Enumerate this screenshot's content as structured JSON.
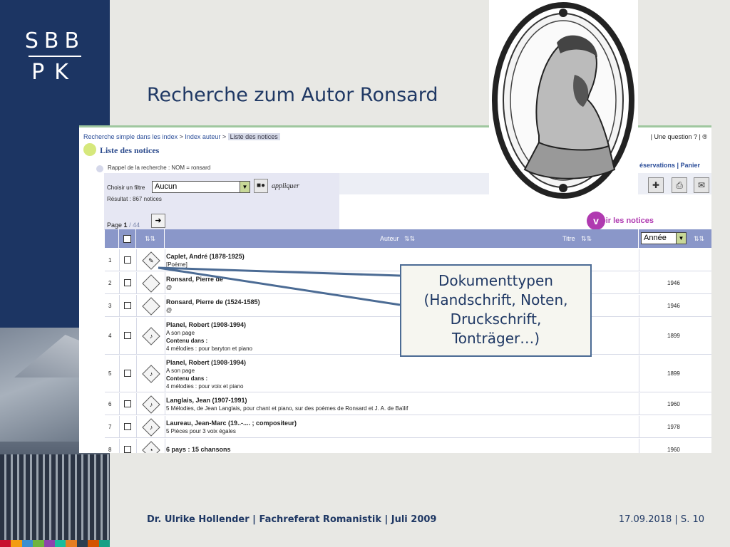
{
  "logo": {
    "line1": "SBB",
    "line2": "PK"
  },
  "slide": {
    "title": "Recherche zum Autor Ronsard"
  },
  "brand_colors": {
    "navy": "#1c3563",
    "accent_purple": "#b03ab0",
    "header_blue": "#8a97c9"
  },
  "app": {
    "breadcrumb": {
      "item1": "Recherche simple dans les index",
      "sep1": " > ",
      "item2": "Index auteur",
      "sep2": " > ",
      "current": "Liste des notices"
    },
    "topright": "| Une question ? | ®",
    "topright2": "éservations | Panier",
    "list_title": "Liste des notices",
    "recall": "Rappel de la recherche : NOM = ronsard",
    "filter": {
      "label": "Choisir un filtre",
      "value": "Aucun",
      "apply_label": "appliquer",
      "apply_icon": "key-icon"
    },
    "result": "Résultat : 867 notices",
    "page": {
      "label": "Page",
      "current": "1",
      "total": " / 44"
    },
    "voir": {
      "letter": "v",
      "label": "oir les notices"
    },
    "table": {
      "col_auteur": "Auteur",
      "col_titre": "Titre",
      "annee_select": "Année",
      "rows": [
        {
          "num": "1",
          "author": "Caplet, André (1878-1925)",
          "lines": [
            "[Poème]"
          ],
          "year": "",
          "icon": "manuscript-icon",
          "glyph": "✎"
        },
        {
          "num": "2",
          "author": "Ronsard, Pierre de",
          "lines": [
            "@"
          ],
          "year": "1946",
          "icon": "print-icon",
          "glyph": ""
        },
        {
          "num": "3",
          "author": "Ronsard, Pierre de (1524-1585)",
          "lines": [
            "@"
          ],
          "year": "1946",
          "icon": "print-icon",
          "glyph": ""
        },
        {
          "num": "4",
          "author": "Planel, Robert (1908-1994)",
          "lines": [
            "A son page",
            "Contenu dans :",
            "4 mélodies : pour baryton et piano"
          ],
          "year": "1899",
          "icon": "score-icon",
          "glyph": "♪"
        },
        {
          "num": "5",
          "author": "Planel, Robert (1908-1994)",
          "lines": [
            "A son page",
            "Contenu dans :",
            "4 mélodies : pour voix et piano"
          ],
          "year": "1899",
          "icon": "score-icon",
          "glyph": "♪"
        },
        {
          "num": "6",
          "author": "Langlais, Jean (1907-1991)",
          "lines": [
            "5 Mélodies, de Jean Langlais, pour chant et piano, sur des poèmes de Ronsard et J. A. de Baïlif"
          ],
          "year": "1960",
          "icon": "score-icon",
          "glyph": "♪"
        },
        {
          "num": "7",
          "author": "Laureau, Jean-Marc (19..-.... ; compositeur)",
          "lines": [
            "5 Pièces pour 3 voix égales"
          ],
          "year": "1978",
          "icon": "score-icon",
          "glyph": "♪"
        },
        {
          "num": "8",
          "author": "6 pays : 15 chansons",
          "lines": [],
          "year": "1960",
          "icon": "sound-recording-icon",
          "glyph": "◔"
        }
      ]
    }
  },
  "callout": {
    "line1": "Dokumenttypen",
    "line2": "(Handschrift, Noten,",
    "line3": "Druckschrift,",
    "line4": "Tonträger…)"
  },
  "footer": {
    "left": "Dr. Ulrike Hollender | Fachreferat Romanistik | Juli 2009",
    "right": "17.09.2018 | S. 10"
  }
}
